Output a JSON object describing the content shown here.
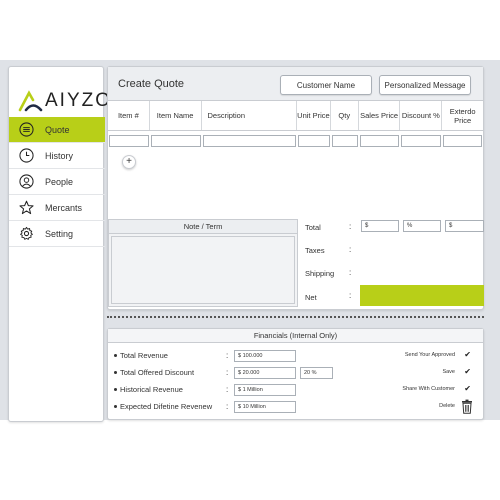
{
  "app": {
    "brand": "AIYZO",
    "accent_color": "#b8cf18"
  },
  "sidebar": {
    "items": [
      {
        "label": "Quote",
        "icon": "list-circle-icon",
        "active": true
      },
      {
        "label": "History",
        "icon": "clock-icon",
        "active": false
      },
      {
        "label": "People",
        "icon": "user-circle-icon",
        "active": false
      },
      {
        "label": "Mercants",
        "icon": "star-icon",
        "active": false
      },
      {
        "label": "Setting",
        "icon": "gear-icon",
        "active": false
      }
    ]
  },
  "quote": {
    "title": "Create Quote",
    "customer_button": "Customer Name",
    "message_button": "Personalized Message",
    "columns": [
      "Item #",
      "Item Name",
      "Description",
      "Unit Price",
      "Qty",
      "Sales Price",
      "Discount %",
      "Exterdo Price"
    ],
    "add_label": "+",
    "note_title": "Note / Term",
    "totals": {
      "total_label": "Total",
      "taxes_label": "Taxes",
      "shipping_label": "Shipping",
      "net_label": "Net",
      "colon": ":",
      "total_prefix_1": "$",
      "total_prefix_2": "%",
      "total_prefix_3": "$"
    }
  },
  "financials": {
    "title": "Financials (Internal Only)",
    "rows": [
      {
        "label": "Total Revenue",
        "value": "$ 100.000"
      },
      {
        "label": "Total Offered Discount",
        "value": "$ 20.000",
        "percent": "20 %"
      },
      {
        "label": "Historical Revenue",
        "value": "$ 1 Million"
      },
      {
        "label": "Expected Difetine Revenew",
        "value": "$ 10 Million"
      }
    ],
    "colon": ":",
    "options": [
      {
        "label": "Send Your Approved",
        "checked": true
      },
      {
        "label": "Save",
        "checked": true
      },
      {
        "label": "Share With Customer",
        "checked": true
      },
      {
        "label": "Delete",
        "icon": "trash-icon"
      }
    ],
    "check_glyph": "✔"
  }
}
